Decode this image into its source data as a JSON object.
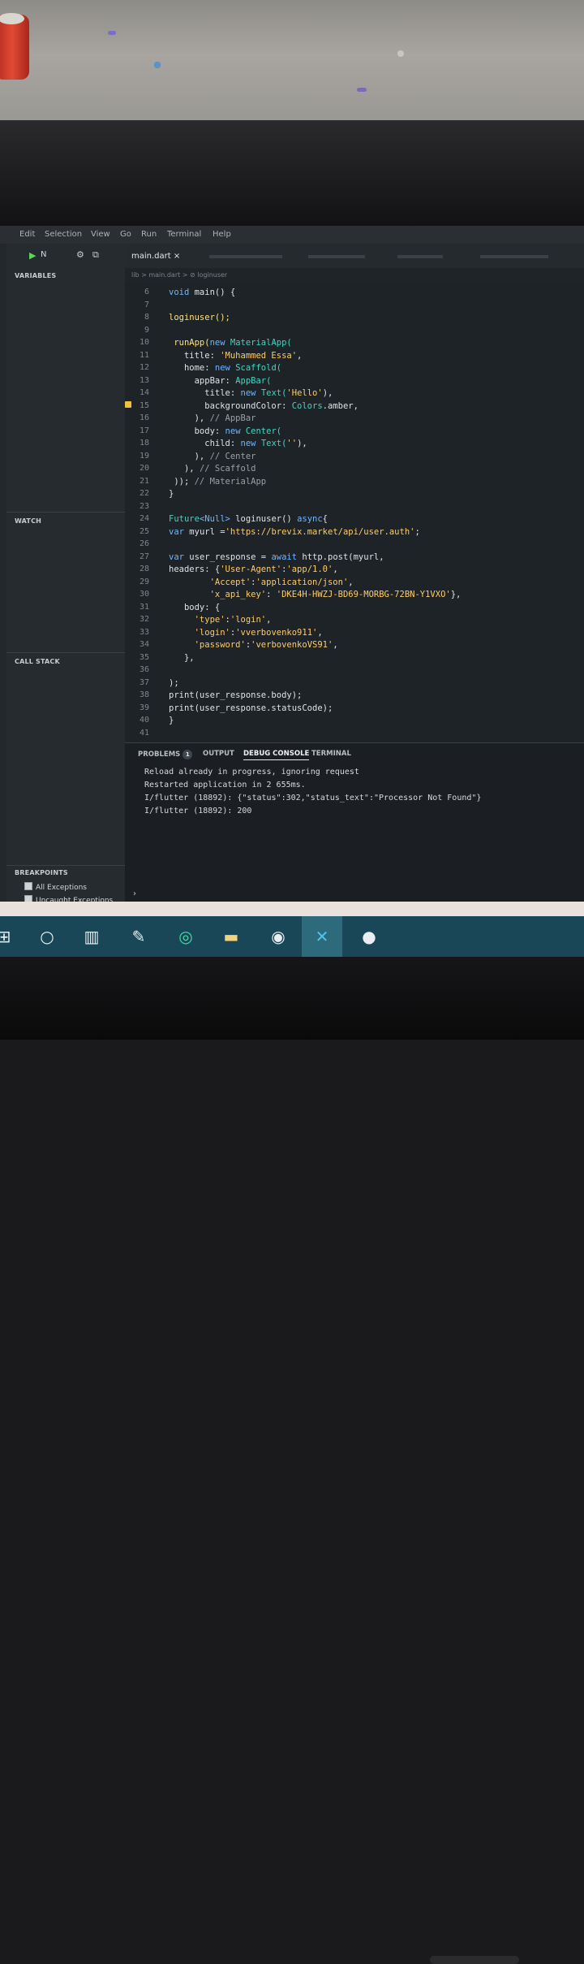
{
  "menu": [
    "Edit",
    "Selection",
    "View",
    "Go",
    "Run",
    "Terminal",
    "Help"
  ],
  "debug": {
    "config_label": "N"
  },
  "sidebar": {
    "variables_title": "VARIABLES",
    "watch_title": "WATCH",
    "callstack_title": "CALL STACK",
    "breakpoints_title": "BREAKPOINTS",
    "breakpoints": [
      "All Exceptions",
      "Uncaught Exceptions"
    ]
  },
  "tabs": [
    "main.dart"
  ],
  "breadcrumb": "lib > main.dart > ⊘ loginuser",
  "editor": {
    "line_numbers": [
      "6",
      "7",
      "8",
      "9",
      "10",
      "11",
      "12",
      "13",
      "14",
      "15",
      "16",
      "17",
      "18",
      "19",
      "20",
      "21",
      "22",
      "23",
      "24",
      "25",
      "26",
      "27",
      "28",
      "29",
      "30",
      "31",
      "32",
      "33",
      "34",
      "35",
      "36",
      "37",
      "38",
      "39",
      "40",
      "41"
    ],
    "lines": [
      {
        "n": 6,
        "segments": [
          {
            "t": "void ",
            "c": "kw"
          },
          {
            "t": "main() {",
            "c": ""
          }
        ]
      },
      {
        "n": 7,
        "segments": []
      },
      {
        "n": 8,
        "segments": [
          {
            "t": "loginuser();",
            "c": "fn"
          }
        ]
      },
      {
        "n": 9,
        "segments": []
      },
      {
        "n": 10,
        "segments": [
          {
            "t": " runApp(",
            "c": "fn"
          },
          {
            "t": "new ",
            "c": "kw"
          },
          {
            "t": "MaterialApp(",
            "c": "cls"
          }
        ]
      },
      {
        "n": 11,
        "segments": [
          {
            "t": "   title: ",
            "c": ""
          },
          {
            "t": "'Muhammed Essa'",
            "c": "str"
          },
          {
            "t": ",",
            "c": ""
          }
        ]
      },
      {
        "n": 12,
        "segments": [
          {
            "t": "   home: ",
            "c": ""
          },
          {
            "t": "new ",
            "c": "kw"
          },
          {
            "t": "Scaffold(",
            "c": "cls"
          }
        ]
      },
      {
        "n": 13,
        "segments": [
          {
            "t": "     appBar: ",
            "c": ""
          },
          {
            "t": "AppBar(",
            "c": "cls"
          }
        ]
      },
      {
        "n": 14,
        "segments": [
          {
            "t": "       title: ",
            "c": ""
          },
          {
            "t": "new ",
            "c": "kw"
          },
          {
            "t": "Text(",
            "c": "cls"
          },
          {
            "t": "'Hello'",
            "c": "str"
          },
          {
            "t": "),",
            "c": ""
          }
        ]
      },
      {
        "n": 15,
        "segments": [
          {
            "t": "       backgroundColor: ",
            "c": ""
          },
          {
            "t": "Colors",
            "c": "cls"
          },
          {
            "t": ".amber,",
            "c": ""
          }
        ]
      },
      {
        "n": 16,
        "segments": [
          {
            "t": "     ), ",
            "c": ""
          },
          {
            "t": "// AppBar",
            "c": "cm"
          }
        ]
      },
      {
        "n": 17,
        "segments": [
          {
            "t": "     body: ",
            "c": ""
          },
          {
            "t": "new ",
            "c": "kw"
          },
          {
            "t": "Center(",
            "c": "cls"
          }
        ]
      },
      {
        "n": 18,
        "segments": [
          {
            "t": "       child: ",
            "c": ""
          },
          {
            "t": "new ",
            "c": "kw"
          },
          {
            "t": "Text(",
            "c": "cls"
          },
          {
            "t": "''",
            "c": "str"
          },
          {
            "t": "),",
            "c": ""
          }
        ]
      },
      {
        "n": 19,
        "segments": [
          {
            "t": "     ), ",
            "c": ""
          },
          {
            "t": "// Center",
            "c": "cm"
          }
        ]
      },
      {
        "n": 20,
        "segments": [
          {
            "t": "   ), ",
            "c": ""
          },
          {
            "t": "// Scaffold",
            "c": "cm"
          }
        ]
      },
      {
        "n": 21,
        "segments": [
          {
            "t": " )); ",
            "c": ""
          },
          {
            "t": "// MaterialApp",
            "c": "cm"
          }
        ]
      },
      {
        "n": 22,
        "segments": [
          {
            "t": "}",
            "c": ""
          }
        ]
      },
      {
        "n": 23,
        "segments": []
      },
      {
        "n": 24,
        "segments": [
          {
            "t": "Future",
            "c": "cls"
          },
          {
            "t": "<Null>",
            "c": "kw"
          },
          {
            "t": " loginuser() ",
            "c": ""
          },
          {
            "t": "async",
            "c": "kw"
          },
          {
            "t": "{",
            "c": ""
          }
        ]
      },
      {
        "n": 25,
        "segments": [
          {
            "t": "var ",
            "c": "kw"
          },
          {
            "t": "myurl =",
            "c": ""
          },
          {
            "t": "'https://brevix.market/api/user.auth'",
            "c": "str"
          },
          {
            "t": ";",
            "c": ""
          }
        ]
      },
      {
        "n": 26,
        "segments": []
      },
      {
        "n": 27,
        "segments": [
          {
            "t": "var ",
            "c": "kw"
          },
          {
            "t": "user_response = ",
            "c": ""
          },
          {
            "t": "await ",
            "c": "kw"
          },
          {
            "t": "http.post(myurl,",
            "c": ""
          }
        ]
      },
      {
        "n": 28,
        "segments": [
          {
            "t": "headers: {",
            "c": ""
          },
          {
            "t": "'User-Agent'",
            "c": "str"
          },
          {
            "t": ":",
            "c": ""
          },
          {
            "t": "'app/1.0'",
            "c": "str"
          },
          {
            "t": ",",
            "c": ""
          }
        ]
      },
      {
        "n": 29,
        "segments": [
          {
            "t": "        ",
            "c": ""
          },
          {
            "t": "'Accept'",
            "c": "str"
          },
          {
            "t": ":",
            "c": ""
          },
          {
            "t": "'application/json'",
            "c": "str"
          },
          {
            "t": ",",
            "c": ""
          }
        ]
      },
      {
        "n": 30,
        "segments": [
          {
            "t": "        ",
            "c": ""
          },
          {
            "t": "'x_api_key'",
            "c": "str"
          },
          {
            "t": ": ",
            "c": ""
          },
          {
            "t": "'DKE4H-HWZJ-BD69-MORBG-72BN-Y1VXO'",
            "c": "str"
          },
          {
            "t": "},",
            "c": ""
          }
        ]
      },
      {
        "n": 31,
        "segments": [
          {
            "t": "   body: {",
            "c": ""
          }
        ]
      },
      {
        "n": 32,
        "segments": [
          {
            "t": "     ",
            "c": ""
          },
          {
            "t": "'type'",
            "c": "str"
          },
          {
            "t": ":",
            "c": ""
          },
          {
            "t": "'login'",
            "c": "str"
          },
          {
            "t": ",",
            "c": ""
          }
        ]
      },
      {
        "n": 33,
        "segments": [
          {
            "t": "     ",
            "c": ""
          },
          {
            "t": "'login'",
            "c": "str"
          },
          {
            "t": ":",
            "c": ""
          },
          {
            "t": "'vverbovenko911'",
            "c": "str"
          },
          {
            "t": ",",
            "c": ""
          }
        ]
      },
      {
        "n": 34,
        "segments": [
          {
            "t": "     ",
            "c": ""
          },
          {
            "t": "'password'",
            "c": "str"
          },
          {
            "t": ":",
            "c": ""
          },
          {
            "t": "'verbovenkoVS91'",
            "c": "str"
          },
          {
            "t": ",",
            "c": ""
          }
        ]
      },
      {
        "n": 35,
        "segments": [
          {
            "t": "   },",
            "c": ""
          }
        ]
      },
      {
        "n": 36,
        "segments": []
      },
      {
        "n": 37,
        "segments": [
          {
            "t": ");",
            "c": ""
          }
        ]
      },
      {
        "n": 38,
        "segments": [
          {
            "t": "print(user_response.body);",
            "c": ""
          }
        ]
      },
      {
        "n": 39,
        "segments": [
          {
            "t": "print(user_response.statusCode);",
            "c": ""
          }
        ]
      },
      {
        "n": 40,
        "segments": [
          {
            "t": "}",
            "c": ""
          }
        ]
      },
      {
        "n": 41,
        "segments": []
      }
    ]
  },
  "panel": {
    "tabs": [
      "PROBLEMS",
      "OUTPUT",
      "DEBUG CONSOLE",
      "TERMINAL"
    ],
    "problems_count": "1",
    "console": [
      "Reload already in progress, ignoring request",
      "Restarted application in 2 655ms.",
      "I/flutter (18892): {\"status\":302,\"status_text\":\"Processor Not Found\"}",
      "I/flutter (18892): 200"
    ]
  },
  "colors": {
    "accent": "#f0c040",
    "taskbar": "#1a4757",
    "editor_bg": "#1e2327"
  }
}
